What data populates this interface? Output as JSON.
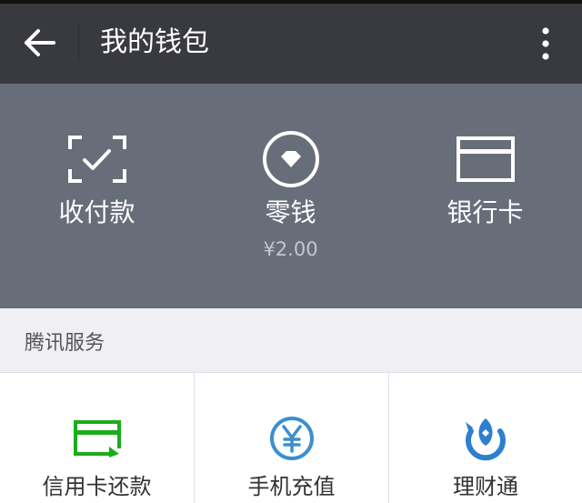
{
  "header": {
    "title": "我的钱包",
    "back_icon": "arrow-left-icon",
    "more_icon": "more-vertical-icon",
    "background": "#393a3f"
  },
  "wallet": {
    "background": "#676d79",
    "items": [
      {
        "label": "收付款",
        "icon": "scan-pay-icon"
      },
      {
        "label": "零钱",
        "icon": "diamond-coin-icon",
        "amount": "¥2.00"
      },
      {
        "label": "银行卡",
        "icon": "bank-card-icon"
      }
    ]
  },
  "services": {
    "section_title": "腾讯服务",
    "items": [
      {
        "label": "信用卡还款",
        "icon": "credit-card-repay-icon",
        "color": "#1aad19"
      },
      {
        "label": "手机充值",
        "icon": "yuan-coin-icon",
        "color": "#3b8fd0"
      },
      {
        "label": "理财通",
        "icon": "licaitong-icon",
        "color": "#2e7fd0"
      }
    ]
  }
}
